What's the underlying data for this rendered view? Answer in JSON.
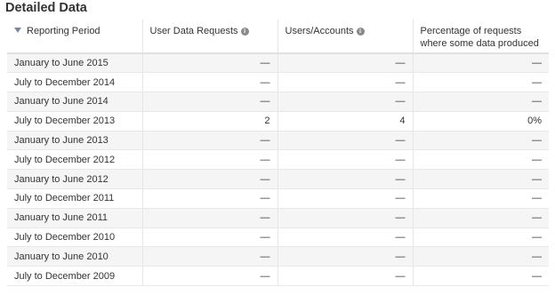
{
  "section_title": "Detailed Data",
  "columns": {
    "period": "Reporting Period",
    "requests": "User Data Requests",
    "users": "Users/Accounts",
    "percentage": "Percentage of requests where some data produced"
  },
  "icons": {
    "sort": "sort-down-icon",
    "info": "info-icon"
  },
  "rows": [
    {
      "period": "January to June 2015",
      "requests": "—",
      "users": "—",
      "percentage": "—"
    },
    {
      "period": "July to December 2014",
      "requests": "—",
      "users": "—",
      "percentage": "—"
    },
    {
      "period": "January to June 2014",
      "requests": "—",
      "users": "—",
      "percentage": "—"
    },
    {
      "period": "July to December 2013",
      "requests": "2",
      "users": "4",
      "percentage": "0%"
    },
    {
      "period": "January to June 2013",
      "requests": "—",
      "users": "—",
      "percentage": "—"
    },
    {
      "period": "July to December 2012",
      "requests": "—",
      "users": "—",
      "percentage": "—"
    },
    {
      "period": "January to June 2012",
      "requests": "—",
      "users": "—",
      "percentage": "—"
    },
    {
      "period": "July to December 2011",
      "requests": "—",
      "users": "—",
      "percentage": "—"
    },
    {
      "period": "January to June 2011",
      "requests": "—",
      "users": "—",
      "percentage": "—"
    },
    {
      "period": "July to December 2010",
      "requests": "—",
      "users": "—",
      "percentage": "—"
    },
    {
      "period": "January to June 2010",
      "requests": "—",
      "users": "—",
      "percentage": "—"
    },
    {
      "period": "July to December 2009",
      "requests": "—",
      "users": "—",
      "percentage": "—"
    }
  ]
}
